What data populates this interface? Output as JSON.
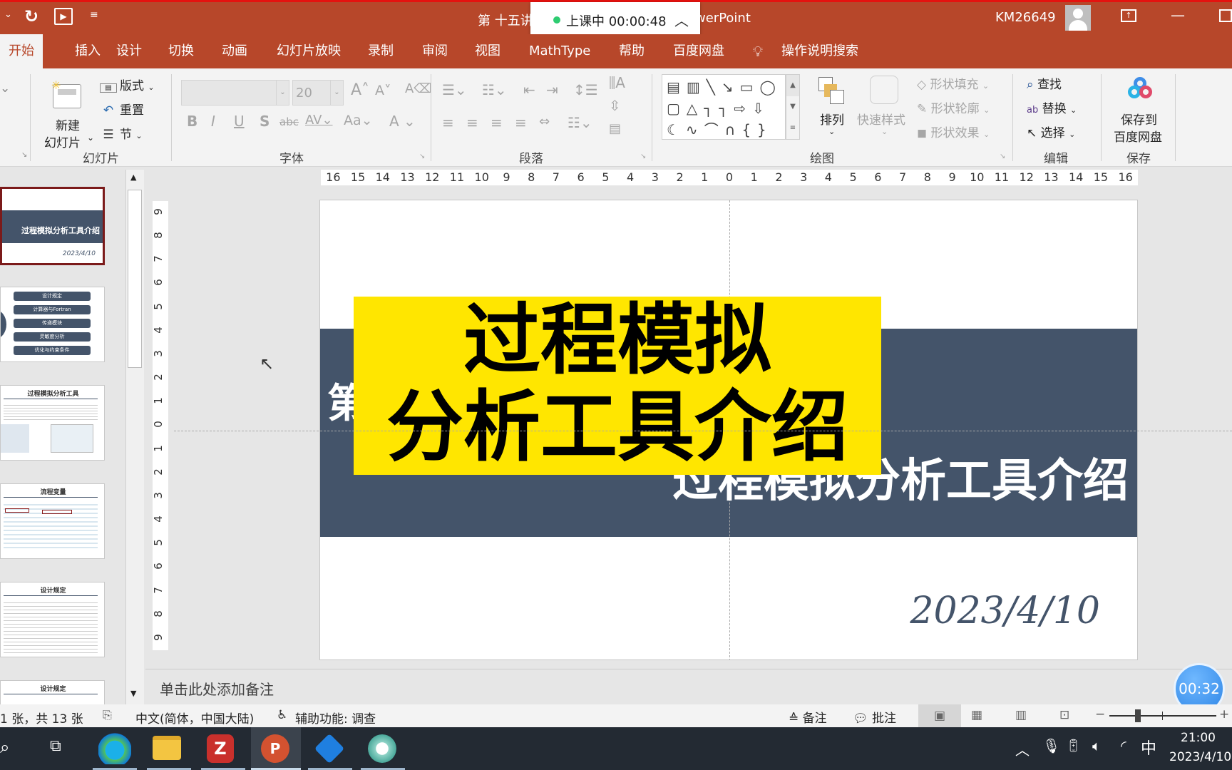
{
  "window": {
    "title_left": "第 十五讲",
    "title_right": "werPoint",
    "user": "KM26649",
    "recording": {
      "status_text": "上课中 00:00:48",
      "dot_color": "#2ecc71"
    }
  },
  "tabs": [
    "开始",
    "插入",
    "设计",
    "切换",
    "动画",
    "幻灯片放映",
    "录制",
    "审阅",
    "视图",
    "MathType",
    "帮助",
    "百度网盘"
  ],
  "active_tab": "开始",
  "tell_me": "操作说明搜索",
  "ribbon": {
    "slides_group": {
      "label": "幻灯片",
      "new_slide_line1": "新建",
      "new_slide_line2": "幻灯片",
      "layout": "版式",
      "reset": "重置",
      "section": "节"
    },
    "font_group": {
      "label": "字体",
      "font_name": "",
      "font_size": "20"
    },
    "paragraph_group": {
      "label": "段落"
    },
    "drawing_group": {
      "label": "绘图",
      "arrange": "排列",
      "quick_styles": "快速样式",
      "shape_fill": "形状填充",
      "shape_outline": "形状轮廓",
      "shape_effects": "形状效果"
    },
    "editing_group": {
      "label": "编辑",
      "find": "查找",
      "replace": "替换",
      "select": "选择"
    },
    "save_group": {
      "label": "保存",
      "save_to_line1": "保存到",
      "save_to_line2": "百度网盘"
    }
  },
  "thumbnails": [
    {
      "index": 1,
      "title": "过程模拟分析工具介绍",
      "date": "2023/4/10",
      "selected": true
    },
    {
      "index": 2,
      "items": [
        "设计规定",
        "计算器与Fortran",
        "传递模块",
        "灵敏度分析",
        "优化与约束条件"
      ]
    },
    {
      "index": 3,
      "title": "过程模拟分析工具"
    },
    {
      "index": 4,
      "title": "流程变量"
    },
    {
      "index": 5,
      "title": "设计规定"
    },
    {
      "index": 6,
      "title": "设计规定"
    }
  ],
  "ruler": {
    "horizontal": [
      "16",
      "15",
      "14",
      "13",
      "12",
      "11",
      "10",
      "9",
      "8",
      "7",
      "6",
      "5",
      "4",
      "3",
      "2",
      "1",
      "0",
      "1",
      "2",
      "3",
      "4",
      "5",
      "6",
      "7",
      "8",
      "9",
      "10",
      "11",
      "12",
      "13",
      "14",
      "15",
      "16"
    ],
    "vertical": [
      "9",
      "8",
      "7",
      "6",
      "5",
      "4",
      "3",
      "2",
      "1",
      "0",
      "1",
      "2",
      "3",
      "4",
      "5",
      "6",
      "7",
      "8",
      "9"
    ]
  },
  "slide": {
    "overlay_line1": "过程模拟",
    "overlay_line2": "分析工具介绍",
    "left_partial": "第",
    "title": "过程模拟分析工具介绍",
    "date": "2023/4/10",
    "band_color": "#44546a",
    "overlay_color": "#ffe600"
  },
  "notes_placeholder": "单击此处添加备注",
  "status": {
    "slide_count": "1 张，共 13 张",
    "language": "中文(简体，中国大陆)",
    "accessibility": "辅助功能: 调查",
    "notes": "备注",
    "comments": "批注"
  },
  "timer_badge": "00:32",
  "clock": {
    "time": "21:00",
    "date": "2023/4/10"
  },
  "tray_ime": "中"
}
